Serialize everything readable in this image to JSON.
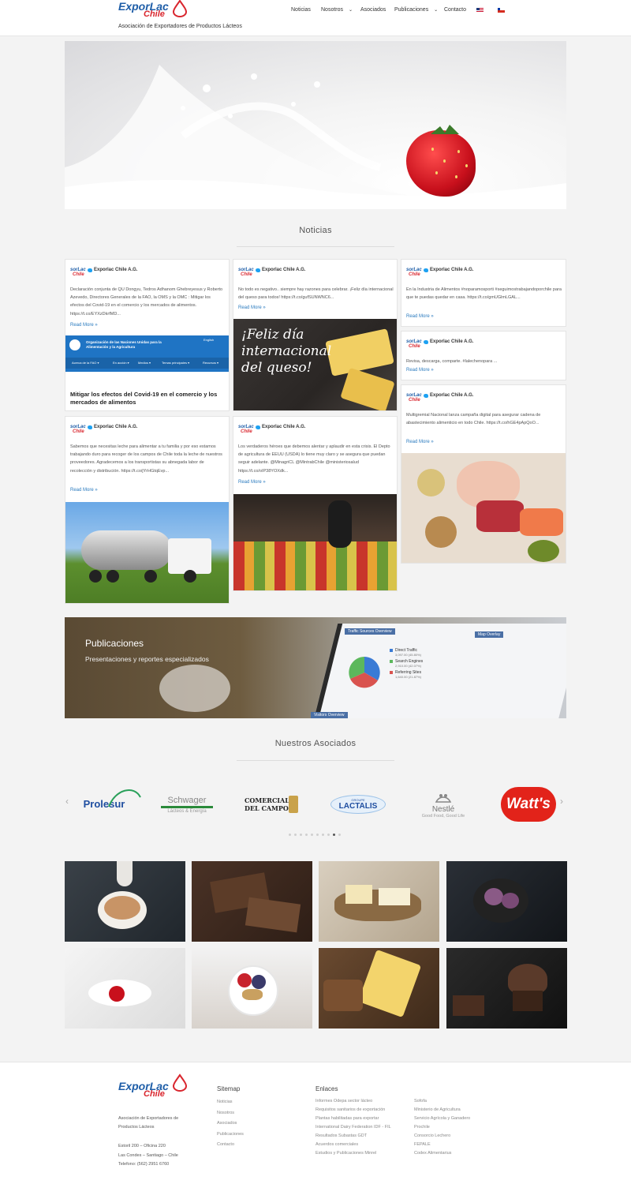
{
  "header": {
    "logo_exporlac": "ExporLac",
    "logo_chile": "Chile",
    "tagline": "Asociación de Exportadores de Productos Lácteos",
    "nav": [
      {
        "label": "Noticias"
      },
      {
        "label": "Nosotros"
      },
      {
        "label": "Asociados"
      },
      {
        "label": "Publicaciones"
      },
      {
        "label": "Contacto"
      }
    ]
  },
  "news": {
    "title": "Noticias",
    "author": "Exporlac Chile A.G.",
    "read_more": "Read More »",
    "cards": [
      {
        "text": "Declaración conjunta de QU Dongyu, Tedros Adhanom Ghebreyesus y Roberto Azevedo, Directores Generales de la FAO, la OMS y la OMC : Mitigar los efectos del Covid-19 en el comercio y los mercados de alimentos. https://t.co/EYXzDkrfMD...",
        "link_title": "Mitigar los efectos del Covid-19 en el comercio y los mercados de alimentos",
        "fao_org": "Organización de las Naciones Unidas para la Alimentación y la Agricultura",
        "fao_langs": "English",
        "fao_menu": [
          "Acerca de la FAO ▾",
          "En acción ▾",
          "Medios ▾",
          "Temas principales ▾",
          "Recursos ▾"
        ]
      },
      {
        "text": "No todo es negativo.. siempre hay razones para celebrar. ¡Feliz día internacional del queso para todos! https://t.co/gufSUNWNC6...",
        "image_caption": "¡Feliz día internacional del queso!"
      },
      {
        "text": "En la Industria de Alimentos #noparamosporti #seguimostrabajandoporchile para que te puedas quedar en casa. https://t.co/gmUGlmLGAL..."
      },
      {
        "text": "Revisa, descarga, comparte. #lalechenopara ..."
      },
      {
        "text": "Multigremial Nacional lanza campaña digital para asegurar cadena de abastecimiento alimenticio en todo Chile. https://t.co/hGE4pApQoO..."
      },
      {
        "text": "Sabemos que necesitas leche para alimentar a tu familia y por eso estamos trabajando duro para recoger de los campos de Chile toda la leche de nuestros proveedores. Agradecemos a los transportistas su abnegada labor de recolección y distribución. https://t.co/jYrHGtqEvp..."
      },
      {
        "text": "Los verdaderos héroes que debemos alentar y aplaudir en esta crisis. El Depto de agricultura de EEUU (USDA) lo tiene muy claro y se asegura que puedan seguir adelante. @MinagriCL @MintrabChile @ministeriosalud https://t.co/oIP38YOXdk..."
      }
    ]
  },
  "publications": {
    "title": "Publicaciones",
    "subtitle": "Presentaciones y reportes especializados",
    "chart_title": "Traffic Sources Overview",
    "map_title": "Map Overlay",
    "footer_title": "Visitors Overview",
    "legend": [
      {
        "label": "Direct Traffic",
        "detail": "3,097.00 (45.80%)",
        "color": "#3a7bd5"
      },
      {
        "label": "Search Engines",
        "detail": "2,910.00 (42.07%)",
        "color": "#5cb85c"
      },
      {
        "label": "Referring Sites",
        "detail": "1,640.00 (21.87%)",
        "color": "#d9534f"
      }
    ]
  },
  "associates": {
    "title": "Nuestros Asociados",
    "logos": [
      {
        "name": "Prolesur"
      },
      {
        "name": "Schwager",
        "sub": "Lácteos & Energía"
      },
      {
        "name": "COMERCIAL DEL CAMPO"
      },
      {
        "name": "LACTALIS",
        "sub": "GROUPE"
      },
      {
        "name": "Nestlé",
        "sub": "Good Food, Good Life"
      },
      {
        "name": "Watt's"
      }
    ],
    "dots_total": 10,
    "dots_active": 8
  },
  "footer": {
    "address_lines": [
      "Asociación de Exportadores de",
      "Productos Lácteos",
      "",
      "Estoril 200 – Oficina 220",
      "Las Condes – Santiago – Chile",
      "Telefono: (562) 2951 6760"
    ],
    "sitemap_title": "Sitemap",
    "sitemap": [
      "Noticias",
      "Nosotros",
      "Asociados",
      "Publicaciones",
      "Contacto"
    ],
    "links_title": "Enlaces",
    "links_col1": [
      "Informes Odepa sector lácteo",
      "Requisitos sanitarios de exportación",
      "Plantas habilitadas para exportar",
      "International Dairy Federation IDF - FIL",
      "Resultados Subastas GDT",
      "Acuerdos comerciales",
      "Estudios y Publicaciones Minrel"
    ],
    "links_col2": [
      "Sofofa",
      "Ministerio de Agricultura",
      "Servicio Agrícola y Ganadero",
      "Prochile",
      "Consorcio Lechero",
      "FEPALE",
      "Codex Alimentarius"
    ]
  }
}
